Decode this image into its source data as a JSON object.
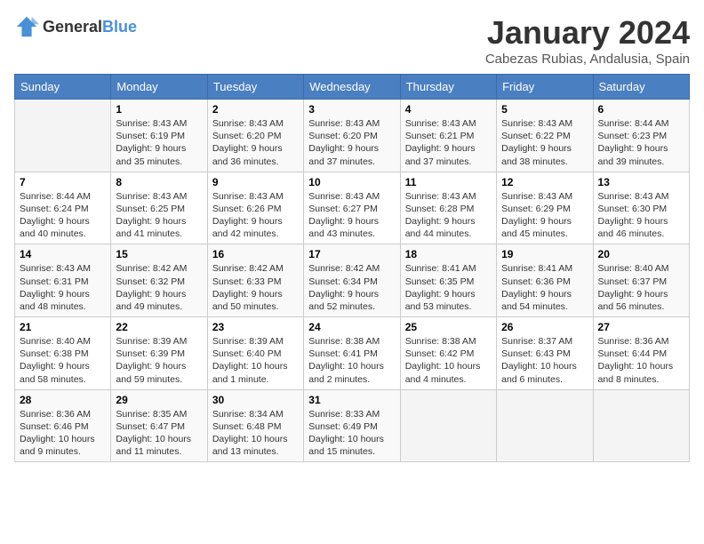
{
  "header": {
    "logo_general": "General",
    "logo_blue": "Blue",
    "month_title": "January 2024",
    "location": "Cabezas Rubias, Andalusia, Spain"
  },
  "days_of_week": [
    "Sunday",
    "Monday",
    "Tuesday",
    "Wednesday",
    "Thursday",
    "Friday",
    "Saturday"
  ],
  "weeks": [
    [
      {
        "day": "",
        "sunrise": "",
        "sunset": "",
        "daylight": ""
      },
      {
        "day": "1",
        "sunrise": "Sunrise: 8:43 AM",
        "sunset": "Sunset: 6:19 PM",
        "daylight": "Daylight: 9 hours and 35 minutes."
      },
      {
        "day": "2",
        "sunrise": "Sunrise: 8:43 AM",
        "sunset": "Sunset: 6:20 PM",
        "daylight": "Daylight: 9 hours and 36 minutes."
      },
      {
        "day": "3",
        "sunrise": "Sunrise: 8:43 AM",
        "sunset": "Sunset: 6:20 PM",
        "daylight": "Daylight: 9 hours and 37 minutes."
      },
      {
        "day": "4",
        "sunrise": "Sunrise: 8:43 AM",
        "sunset": "Sunset: 6:21 PM",
        "daylight": "Daylight: 9 hours and 37 minutes."
      },
      {
        "day": "5",
        "sunrise": "Sunrise: 8:43 AM",
        "sunset": "Sunset: 6:22 PM",
        "daylight": "Daylight: 9 hours and 38 minutes."
      },
      {
        "day": "6",
        "sunrise": "Sunrise: 8:44 AM",
        "sunset": "Sunset: 6:23 PM",
        "daylight": "Daylight: 9 hours and 39 minutes."
      }
    ],
    [
      {
        "day": "7",
        "sunrise": "Sunrise: 8:44 AM",
        "sunset": "Sunset: 6:24 PM",
        "daylight": "Daylight: 9 hours and 40 minutes."
      },
      {
        "day": "8",
        "sunrise": "Sunrise: 8:43 AM",
        "sunset": "Sunset: 6:25 PM",
        "daylight": "Daylight: 9 hours and 41 minutes."
      },
      {
        "day": "9",
        "sunrise": "Sunrise: 8:43 AM",
        "sunset": "Sunset: 6:26 PM",
        "daylight": "Daylight: 9 hours and 42 minutes."
      },
      {
        "day": "10",
        "sunrise": "Sunrise: 8:43 AM",
        "sunset": "Sunset: 6:27 PM",
        "daylight": "Daylight: 9 hours and 43 minutes."
      },
      {
        "day": "11",
        "sunrise": "Sunrise: 8:43 AM",
        "sunset": "Sunset: 6:28 PM",
        "daylight": "Daylight: 9 hours and 44 minutes."
      },
      {
        "day": "12",
        "sunrise": "Sunrise: 8:43 AM",
        "sunset": "Sunset: 6:29 PM",
        "daylight": "Daylight: 9 hours and 45 minutes."
      },
      {
        "day": "13",
        "sunrise": "Sunrise: 8:43 AM",
        "sunset": "Sunset: 6:30 PM",
        "daylight": "Daylight: 9 hours and 46 minutes."
      }
    ],
    [
      {
        "day": "14",
        "sunrise": "Sunrise: 8:43 AM",
        "sunset": "Sunset: 6:31 PM",
        "daylight": "Daylight: 9 hours and 48 minutes."
      },
      {
        "day": "15",
        "sunrise": "Sunrise: 8:42 AM",
        "sunset": "Sunset: 6:32 PM",
        "daylight": "Daylight: 9 hours and 49 minutes."
      },
      {
        "day": "16",
        "sunrise": "Sunrise: 8:42 AM",
        "sunset": "Sunset: 6:33 PM",
        "daylight": "Daylight: 9 hours and 50 minutes."
      },
      {
        "day": "17",
        "sunrise": "Sunrise: 8:42 AM",
        "sunset": "Sunset: 6:34 PM",
        "daylight": "Daylight: 9 hours and 52 minutes."
      },
      {
        "day": "18",
        "sunrise": "Sunrise: 8:41 AM",
        "sunset": "Sunset: 6:35 PM",
        "daylight": "Daylight: 9 hours and 53 minutes."
      },
      {
        "day": "19",
        "sunrise": "Sunrise: 8:41 AM",
        "sunset": "Sunset: 6:36 PM",
        "daylight": "Daylight: 9 hours and 54 minutes."
      },
      {
        "day": "20",
        "sunrise": "Sunrise: 8:40 AM",
        "sunset": "Sunset: 6:37 PM",
        "daylight": "Daylight: 9 hours and 56 minutes."
      }
    ],
    [
      {
        "day": "21",
        "sunrise": "Sunrise: 8:40 AM",
        "sunset": "Sunset: 6:38 PM",
        "daylight": "Daylight: 9 hours and 58 minutes."
      },
      {
        "day": "22",
        "sunrise": "Sunrise: 8:39 AM",
        "sunset": "Sunset: 6:39 PM",
        "daylight": "Daylight: 9 hours and 59 minutes."
      },
      {
        "day": "23",
        "sunrise": "Sunrise: 8:39 AM",
        "sunset": "Sunset: 6:40 PM",
        "daylight": "Daylight: 10 hours and 1 minute."
      },
      {
        "day": "24",
        "sunrise": "Sunrise: 8:38 AM",
        "sunset": "Sunset: 6:41 PM",
        "daylight": "Daylight: 10 hours and 2 minutes."
      },
      {
        "day": "25",
        "sunrise": "Sunrise: 8:38 AM",
        "sunset": "Sunset: 6:42 PM",
        "daylight": "Daylight: 10 hours and 4 minutes."
      },
      {
        "day": "26",
        "sunrise": "Sunrise: 8:37 AM",
        "sunset": "Sunset: 6:43 PM",
        "daylight": "Daylight: 10 hours and 6 minutes."
      },
      {
        "day": "27",
        "sunrise": "Sunrise: 8:36 AM",
        "sunset": "Sunset: 6:44 PM",
        "daylight": "Daylight: 10 hours and 8 minutes."
      }
    ],
    [
      {
        "day": "28",
        "sunrise": "Sunrise: 8:36 AM",
        "sunset": "Sunset: 6:46 PM",
        "daylight": "Daylight: 10 hours and 9 minutes."
      },
      {
        "day": "29",
        "sunrise": "Sunrise: 8:35 AM",
        "sunset": "Sunset: 6:47 PM",
        "daylight": "Daylight: 10 hours and 11 minutes."
      },
      {
        "day": "30",
        "sunrise": "Sunrise: 8:34 AM",
        "sunset": "Sunset: 6:48 PM",
        "daylight": "Daylight: 10 hours and 13 minutes."
      },
      {
        "day": "31",
        "sunrise": "Sunrise: 8:33 AM",
        "sunset": "Sunset: 6:49 PM",
        "daylight": "Daylight: 10 hours and 15 minutes."
      },
      {
        "day": "",
        "sunrise": "",
        "sunset": "",
        "daylight": ""
      },
      {
        "day": "",
        "sunrise": "",
        "sunset": "",
        "daylight": ""
      },
      {
        "day": "",
        "sunrise": "",
        "sunset": "",
        "daylight": ""
      }
    ]
  ]
}
